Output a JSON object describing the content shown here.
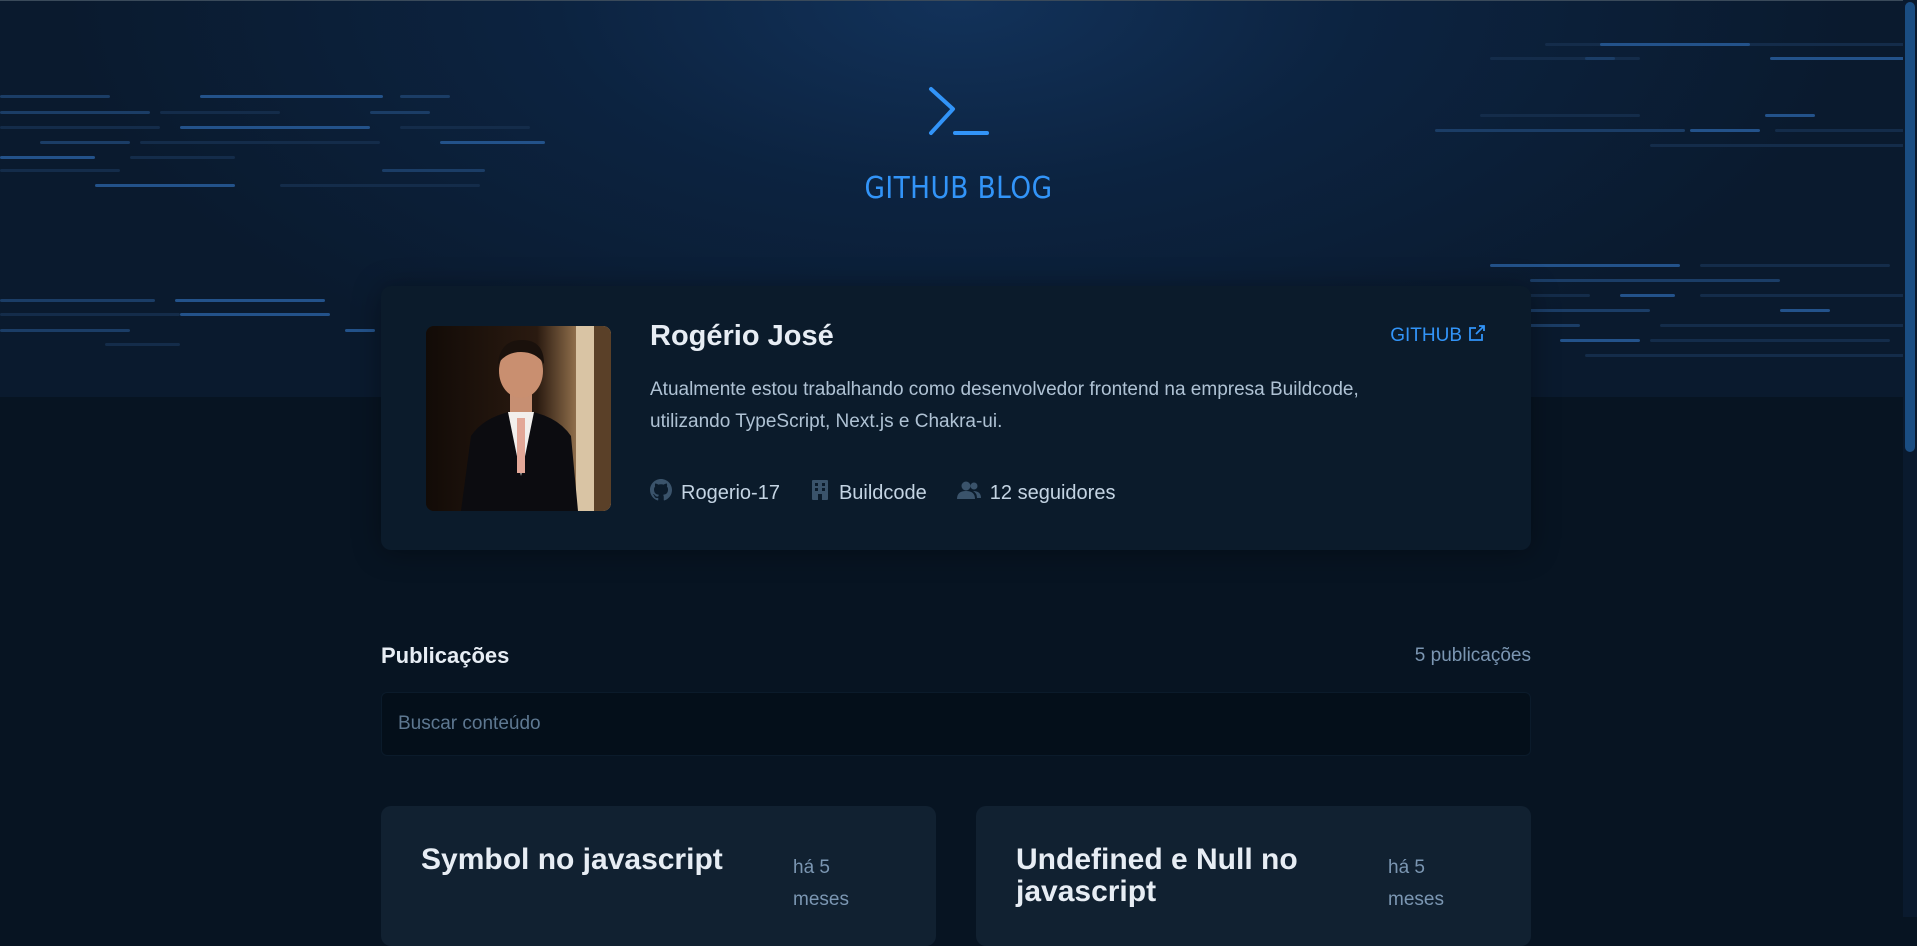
{
  "header": {
    "brand_title": "GITHUB BLOG",
    "brand_icon": "terminal-prompt-icon",
    "accent_color": "#3294F8"
  },
  "profile": {
    "name": "Rogério José",
    "github_link_label": "GITHUB",
    "bio": "Atualmente estou trabalhando como desenvolvedor frontend na empresa Buildcode, utilizando TypeScript, Next.js e Chakra-ui.",
    "username": "Rogerio-17",
    "company": "Buildcode",
    "followers": "12 seguidores",
    "icons": {
      "username": "github-icon",
      "company": "building-icon",
      "followers": "users-icon",
      "link": "external-link-icon"
    }
  },
  "publications": {
    "title": "Publicações",
    "count": "5 publicações",
    "search_placeholder": "Buscar conteúdo",
    "posts": [
      {
        "title": "Symbol no javascript",
        "date": "há 5 meses"
      },
      {
        "title": "Undefined e Null no javascript",
        "date": "há 5 meses"
      }
    ]
  },
  "colors": {
    "background": "#071422",
    "profile_card": "#0B1B2B",
    "post_card": "#112131",
    "title_text": "#E7EDF4",
    "muted_text": "#7B96B2"
  }
}
